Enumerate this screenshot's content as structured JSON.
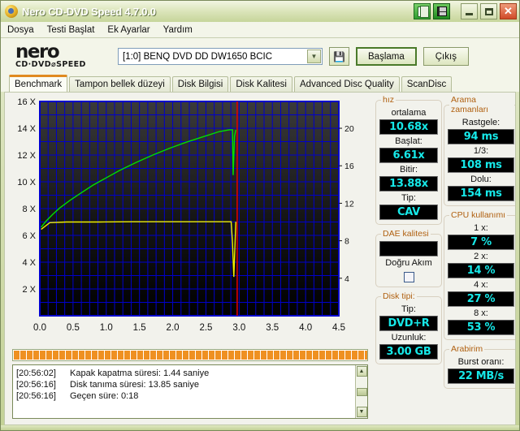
{
  "window": {
    "title": "Nero CD-DVD Speed 4.7.0.0",
    "app_icon": "nero-disc-icon",
    "buttons": {
      "copy": "copy-icon",
      "save": "save-icon",
      "minimize": "_",
      "maximize": "□",
      "close": "✕"
    }
  },
  "menu": {
    "items": [
      "Dosya",
      "Testi Başlat",
      "Ek Ayarlar",
      "Yardım"
    ]
  },
  "toolbar": {
    "logo_main": "nero",
    "logo_sub": "CD·DVD⌀SPEED",
    "drive": "[1:0]   BENQ DVD DD DW1650 BCIC",
    "eject_icon": "eject-disc-icon",
    "start_label": "Başlama",
    "exit_label": "Çıkış"
  },
  "tabs": [
    {
      "label": "Benchmark",
      "active": true
    },
    {
      "label": "Tampon bellek düzeyi",
      "active": false
    },
    {
      "label": "Disk Bilgisi",
      "active": false
    },
    {
      "label": "Disk Kalitesi",
      "active": false
    },
    {
      "label": "Advanced Disc Quality",
      "active": false
    },
    {
      "label": "ScanDisc",
      "active": false
    }
  ],
  "chart_data": {
    "type": "line",
    "title": "",
    "xlabel": "",
    "ylabel": "",
    "xlim": [
      0.0,
      4.5
    ],
    "ylim_left": [
      0,
      16
    ],
    "ylim_right": [
      0,
      22.86
    ],
    "grid": true,
    "background": "#000000",
    "grid_color": "#0000cc",
    "x_ticks": [
      "0.0",
      "0.5",
      "1.0",
      "1.5",
      "2.0",
      "2.5",
      "3.0",
      "3.5",
      "4.0",
      "4.5"
    ],
    "y_ticks_left": [
      "2 X",
      "4 X",
      "6 X",
      "8 X",
      "10 X",
      "12 X",
      "14 X",
      "16 X"
    ],
    "y_ticks_right": [
      "4",
      "8",
      "12",
      "16",
      "20"
    ],
    "series": [
      {
        "name": "read-speed",
        "color": "#00e000",
        "axis": "left",
        "x": [
          0.02,
          0.1,
          0.2,
          0.3,
          0.45,
          0.6,
          0.8,
          1.0,
          1.2,
          1.45,
          1.7,
          1.95,
          2.2,
          2.45,
          2.7,
          2.85,
          2.9,
          2.91,
          2.93,
          2.95
        ],
        "y": [
          6.61,
          7.1,
          7.6,
          8.05,
          8.6,
          9.1,
          9.75,
          10.3,
          10.85,
          11.45,
          12.0,
          12.5,
          12.95,
          13.35,
          13.75,
          13.88,
          13.88,
          10.5,
          13.4,
          13.88
        ]
      },
      {
        "name": "transfer-rate",
        "color": "#f0f000",
        "axis": "left",
        "x": [
          0.02,
          0.15,
          0.4,
          0.9,
          1.4,
          1.9,
          2.4,
          2.8,
          2.88,
          2.9,
          2.92,
          2.95
        ],
        "y": [
          6.45,
          6.95,
          7.0,
          7.0,
          7.02,
          7.02,
          7.02,
          7.02,
          7.02,
          5.4,
          2.9,
          7.02
        ]
      }
    ],
    "marker": {
      "name": "end-of-disc-marker",
      "x": 2.97,
      "color": "#dd0000"
    }
  },
  "progress": {
    "percent": 100,
    "segments": 58,
    "color": "#ef9021"
  },
  "log": {
    "lines": [
      {
        "time": "[20:56:02]",
        "text": "Kapak kapatma süresi: 1.44 saniye"
      },
      {
        "time": "[20:56:16]",
        "text": "Disk tanıma süresi: 13.85 saniye"
      },
      {
        "time": "[20:56:16]",
        "text": "Geçen süre:  0:18"
      }
    ],
    "scroll_up": "▲",
    "scroll_down": "▼"
  },
  "panels": {
    "speed": {
      "legend": "hız",
      "rows": [
        {
          "label": "ortalama",
          "value": "10.68x"
        },
        {
          "label": "Başlat:",
          "value": "6.61x"
        },
        {
          "label": "Bitir:",
          "value": "13.88x"
        },
        {
          "label": "Tip:",
          "value": "CAV"
        }
      ]
    },
    "dae": {
      "legend": "DAE kalitesi",
      "value": "",
      "label": "Doğru Akım",
      "checked": false
    },
    "disk_type": {
      "legend": "Disk tipi:",
      "rows": [
        {
          "label": "Tip:",
          "value": "DVD+R"
        },
        {
          "label": "Uzunluk:",
          "value": "3.00 GB"
        }
      ]
    },
    "seek": {
      "legend": "Arama zamanları",
      "rows": [
        {
          "label": "Rastgele:",
          "value": "94 ms"
        },
        {
          "label": "1/3:",
          "value": "108 ms"
        },
        {
          "label": "Dolu:",
          "value": "154 ms"
        }
      ]
    },
    "cpu": {
      "legend": "CPU kullanımı",
      "rows": [
        {
          "label": "1 x:",
          "value": "7 %"
        },
        {
          "label": "2 x:",
          "value": "14 %"
        },
        {
          "label": "4 x:",
          "value": "27 %"
        },
        {
          "label": "8 x:",
          "value": "53 %"
        }
      ]
    },
    "interface": {
      "legend": "Arabirim",
      "rows": [
        {
          "label": "Burst oranı:",
          "value": "22 MB/s"
        }
      ]
    }
  },
  "colors": {
    "lcd_text": "#16e8e8",
    "lcd_bg": "#000000",
    "legend": "#b06010",
    "accent_tab": "#e08a20"
  }
}
